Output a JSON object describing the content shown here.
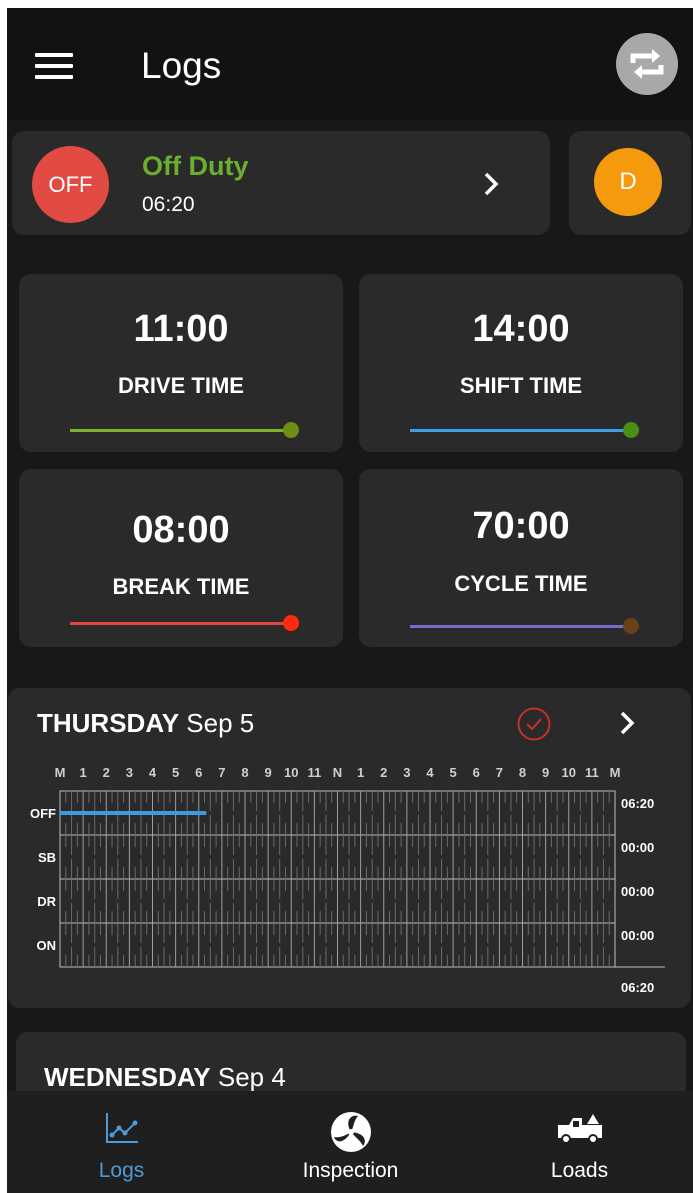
{
  "header": {
    "title": "Logs",
    "menu_icon": "hamburger-menu-icon",
    "sync_icon": "sync-icon"
  },
  "status": {
    "badge": "OFF",
    "label": "Off Duty",
    "time": "06:20",
    "badge_color": "#e24b44",
    "label_color": "#6cae2e"
  },
  "driver": {
    "initial": "D",
    "color": "#f59a0c"
  },
  "timers": [
    {
      "value": "11:00",
      "label": "DRIVE TIME",
      "bar_color": "#7cb32a",
      "dot_color": "#6f8e12",
      "progress": 1.0
    },
    {
      "value": "14:00",
      "label": "SHIFT TIME",
      "bar_color": "#3f9fe4",
      "dot_color": "#4a8e16",
      "progress": 1.0
    },
    {
      "value": "08:00",
      "label": "BREAK TIME",
      "bar_color": "#e0483f",
      "dot_color": "#ff2a10",
      "progress": 1.0
    },
    {
      "value": "70:00",
      "label": "CYCLE TIME",
      "bar_color": "#7a6ad0",
      "dot_color": "#6a4018",
      "progress": 1.0
    }
  ],
  "log_day": {
    "weekday": "THURSDAY",
    "date": "Sep 5",
    "hour_labels": [
      "M",
      "1",
      "2",
      "3",
      "4",
      "5",
      "6",
      "7",
      "8",
      "9",
      "10",
      "11",
      "N",
      "1",
      "2",
      "3",
      "4",
      "5",
      "6",
      "7",
      "8",
      "9",
      "10",
      "11",
      "M"
    ],
    "rows": [
      {
        "label": "OFF",
        "total": "06:20"
      },
      {
        "label": "SB",
        "total": "00:00"
      },
      {
        "label": "DR",
        "total": "00:00"
      },
      {
        "label": "ON",
        "total": "00:00"
      }
    ],
    "grand_total": "06:20",
    "segments": [
      {
        "status": "OFF",
        "start_hour": 0,
        "end_hour": 6.33
      }
    ],
    "segment_color": "#3a9be0",
    "check_color": "#c8302c"
  },
  "next_day": {
    "weekday": "WEDNESDAY",
    "date": "Sep 4"
  },
  "nav": [
    {
      "label": "Logs",
      "icon": "chart-icon",
      "active": true
    },
    {
      "label": "Inspection",
      "icon": "inspection-icon",
      "active": false
    },
    {
      "label": "Loads",
      "icon": "truck-icon",
      "active": false
    }
  ]
}
